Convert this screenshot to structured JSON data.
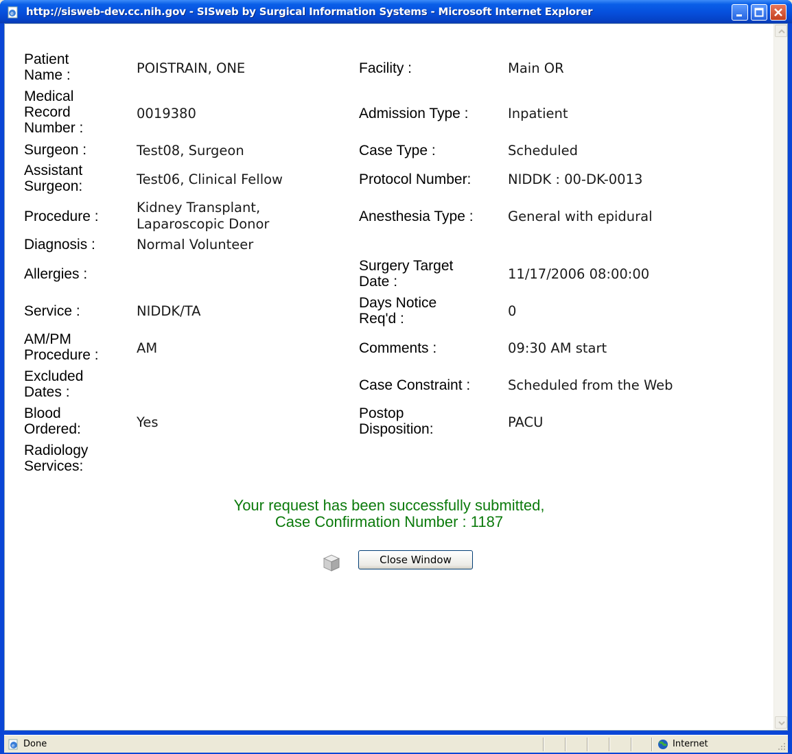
{
  "window": {
    "title": "http://sisweb-dev.cc.nih.gov - SISweb by Surgical Information Systems - Microsoft Internet Explorer"
  },
  "left_fields": [
    {
      "label": "Patient\nName :",
      "value": "POISTRAIN, ONE"
    },
    {
      "label": "Medical\nRecord\nNumber :",
      "value": "0019380"
    },
    {
      "label": "Surgeon :",
      "value": "Test08, Surgeon"
    },
    {
      "label": "Assistant\nSurgeon:",
      "value": "Test06, Clinical Fellow"
    },
    {
      "label": "Procedure :",
      "value": "Kidney Transplant,\nLaparoscopic Donor"
    },
    {
      "label": "Diagnosis :",
      "value": "Normal Volunteer"
    },
    {
      "label": "Allergies :",
      "value": ""
    },
    {
      "label": "Service :",
      "value": "NIDDK/TA"
    },
    {
      "label": "AM/PM\nProcedure :",
      "value": "AM"
    },
    {
      "label": "Excluded\nDates :",
      "value": ""
    },
    {
      "label": "Blood\nOrdered:",
      "value": "Yes"
    },
    {
      "label": "Radiology\nServices:",
      "value": ""
    }
  ],
  "right_fields": [
    {
      "label": "Facility :",
      "value": "Main OR"
    },
    {
      "label": "Admission Type :",
      "value": "Inpatient"
    },
    {
      "label": "Case Type :",
      "value": "Scheduled"
    },
    {
      "label": "Protocol Number:",
      "value": "NIDDK : 00-DK-0013"
    },
    {
      "label": "Anesthesia Type :",
      "value": "General with epidural"
    },
    {
      "label": "",
      "value": ""
    },
    {
      "label": "Surgery Target\nDate :",
      "value": "11/17/2006 08:00:00"
    },
    {
      "label": "Days Notice\nReq'd :",
      "value": "0"
    },
    {
      "label": "Comments :",
      "value": "09:30 AM start"
    },
    {
      "label": "Case Constraint :",
      "value": "Scheduled from the Web"
    },
    {
      "label": "Postop\nDisposition:",
      "value": "PACU"
    }
  ],
  "confirmation": {
    "line1": "Your request has been successfully submitted,",
    "line2": "Case Confirmation Number : 1187"
  },
  "close_button_label": "Close Window",
  "status": {
    "text": "Done",
    "zone": "Internet"
  },
  "colors": {
    "success": "#0b7a0b",
    "titlebar": "#0651de"
  }
}
